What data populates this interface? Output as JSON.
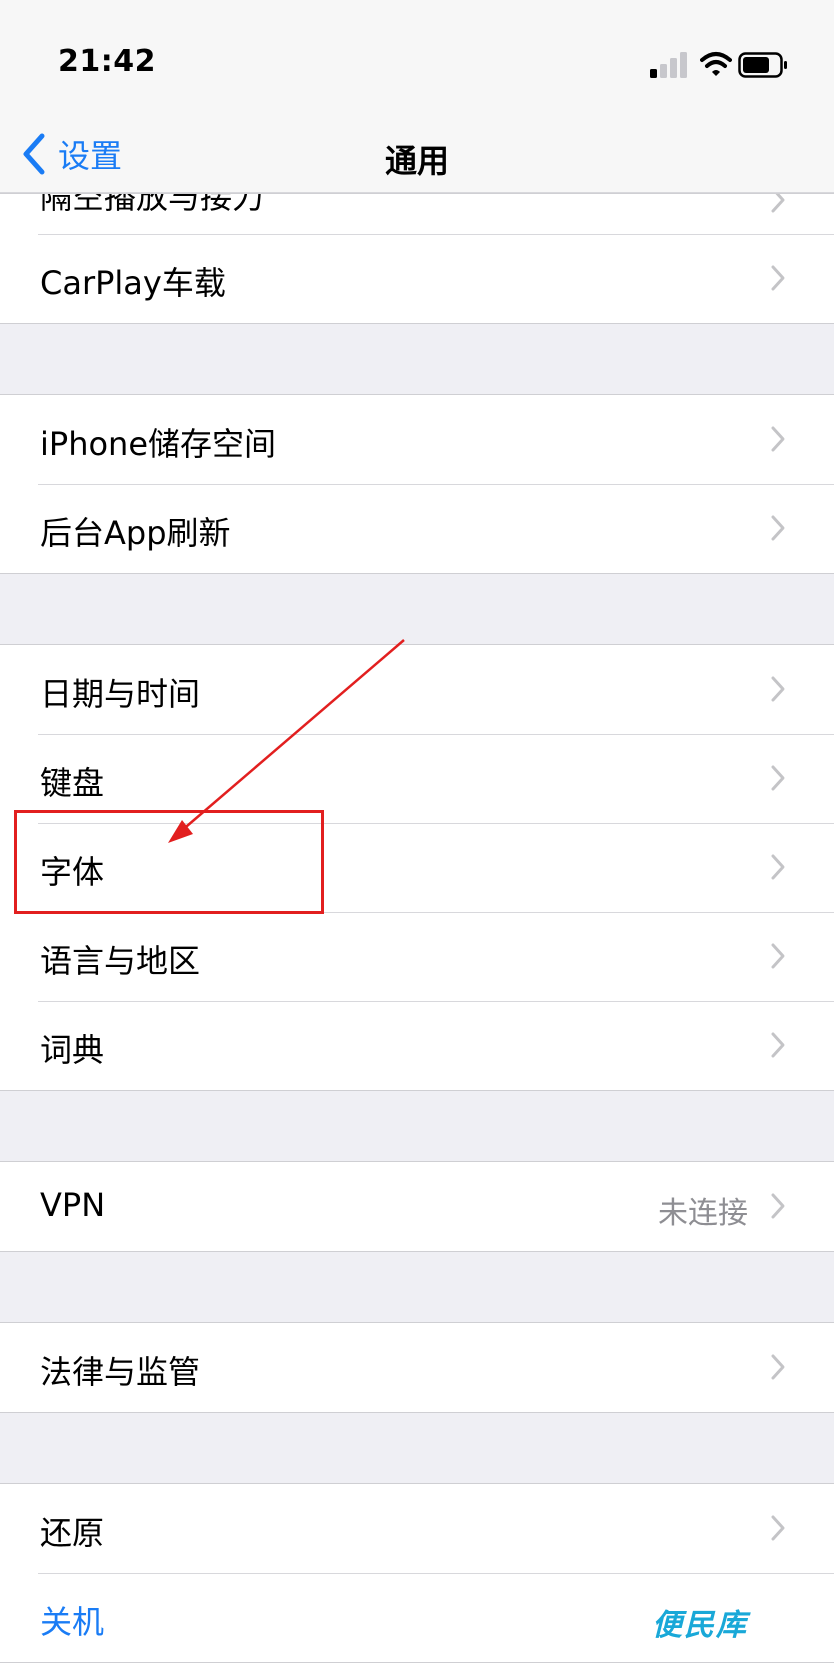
{
  "status_bar": {
    "time": "21:42",
    "signal_icon": "signal-icon",
    "wifi_icon": "wifi-icon",
    "battery_icon": "battery-icon"
  },
  "nav": {
    "back_label": "设置",
    "title": "通用"
  },
  "groups": [
    {
      "rows": [
        {
          "label": "隔空播放与接力"
        },
        {
          "label": "CarPlay车载"
        }
      ]
    },
    {
      "rows": [
        {
          "label": "iPhone储存空间"
        },
        {
          "label": "后台App刷新"
        }
      ]
    },
    {
      "rows": [
        {
          "label": "日期与时间"
        },
        {
          "label": "键盘"
        },
        {
          "label": "字体"
        },
        {
          "label": "语言与地区"
        },
        {
          "label": "词典"
        }
      ]
    },
    {
      "rows": [
        {
          "label": "VPN",
          "value": "未连接"
        }
      ]
    },
    {
      "rows": [
        {
          "label": "法律与监管"
        }
      ]
    },
    {
      "rows": [
        {
          "label": "还原"
        },
        {
          "label": "关机"
        }
      ]
    }
  ],
  "colors": {
    "accent": "#1a7cf5",
    "annotation": "#e21f1f",
    "background": "#efeff4"
  },
  "watermark": "便民库"
}
